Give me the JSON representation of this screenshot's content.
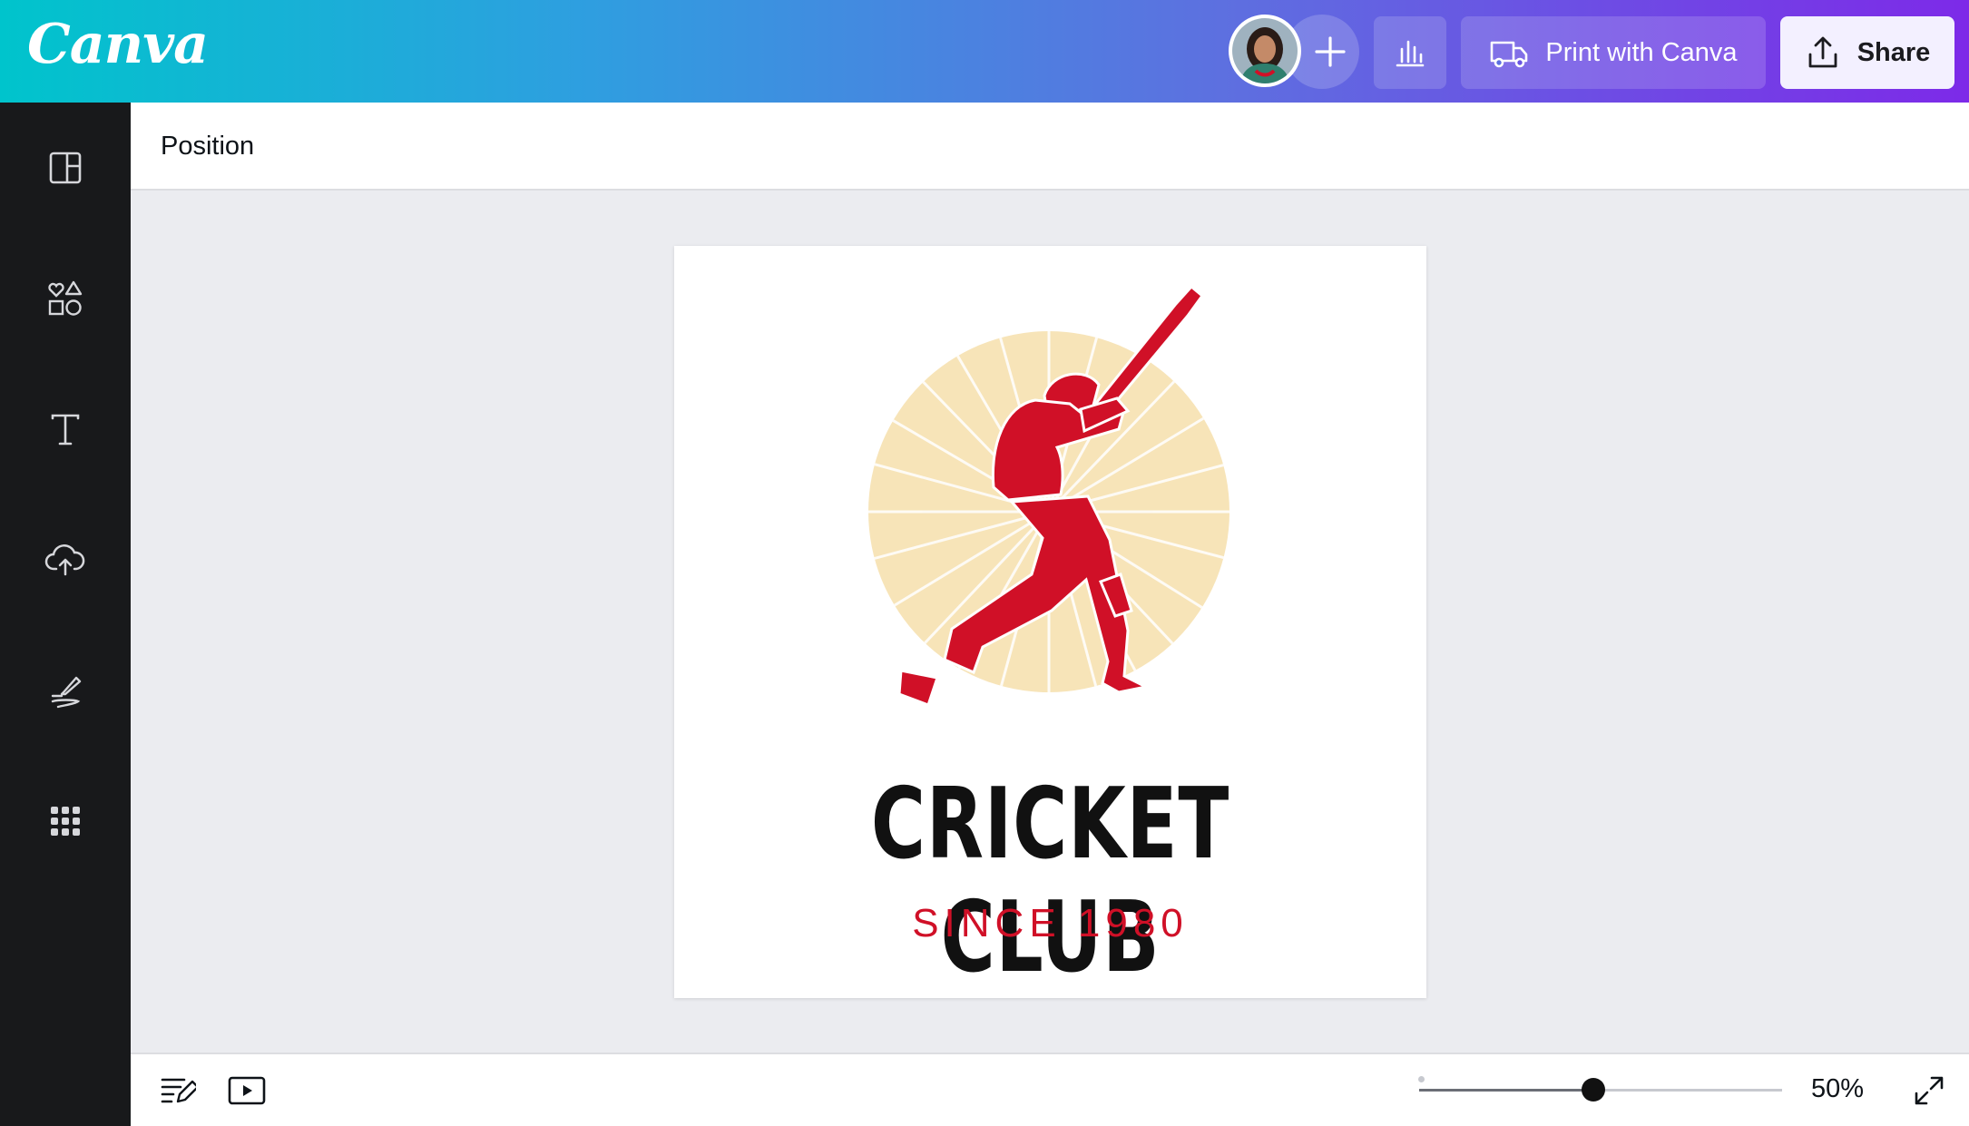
{
  "header": {
    "logo": "Canva",
    "print_label": "Print with Canva",
    "share_label": "Share"
  },
  "sidebar": {
    "items": [
      {
        "icon": "layout-icon"
      },
      {
        "icon": "elements-icon"
      },
      {
        "icon": "text-icon"
      },
      {
        "icon": "upload-icon"
      },
      {
        "icon": "draw-icon"
      },
      {
        "icon": "apps-icon"
      }
    ]
  },
  "toolbar": {
    "label": "Position"
  },
  "design": {
    "title": "CRICKET CLUB",
    "subtitle": "SINCE 1980",
    "colors": {
      "accent_red": "#d01027",
      "sunburst": "#f7e4b8",
      "title": "#111111"
    }
  },
  "footer": {
    "zoom_value": "50%",
    "zoom_level": 0.5
  }
}
